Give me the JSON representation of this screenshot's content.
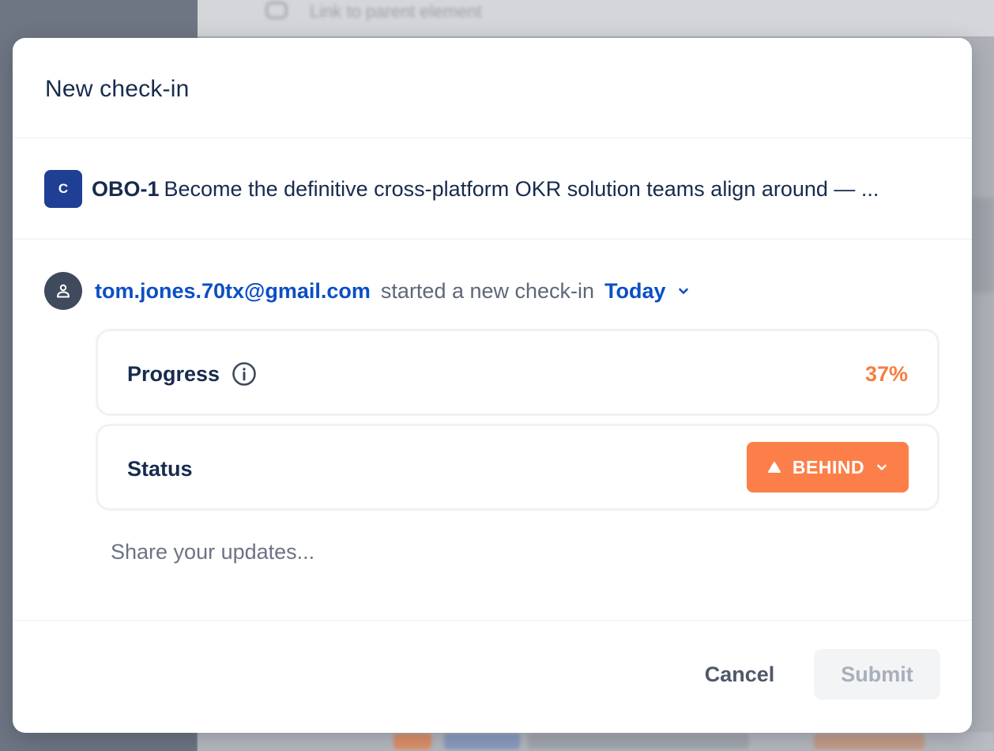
{
  "background": {
    "topbar_text": "Link to parent element"
  },
  "modal": {
    "title": "New check-in"
  },
  "objective": {
    "avatar_letter": "C",
    "key": "OBO-1",
    "title": "Become the definitive cross-platform OKR solution teams align around — ..."
  },
  "checkin": {
    "user_email": "tom.jones.70tx@gmail.com",
    "action_text": "started a new check-in",
    "date_label": "Today",
    "progress": {
      "label": "Progress",
      "value": "37%",
      "percent": 37
    },
    "status": {
      "label": "Status",
      "value": "BEHIND"
    },
    "updates": {
      "placeholder": "Share your updates...",
      "value": ""
    }
  },
  "footer": {
    "cancel_label": "Cancel",
    "submit_label": "Submit"
  },
  "icons": {
    "user": "person-icon",
    "info": "info-circle-icon",
    "date_chevron": "chevron-down-icon",
    "status_indicator": "triangle-up-icon",
    "status_chevron": "chevron-down-icon",
    "topbar": "link-icon"
  },
  "colors": {
    "primary_blue": "#0b4fc6",
    "objective_badge": "#1e3f94",
    "behind_orange": "#fc7f4a",
    "progress_orange": "#f57e3f",
    "text_dark": "#172b4d"
  }
}
